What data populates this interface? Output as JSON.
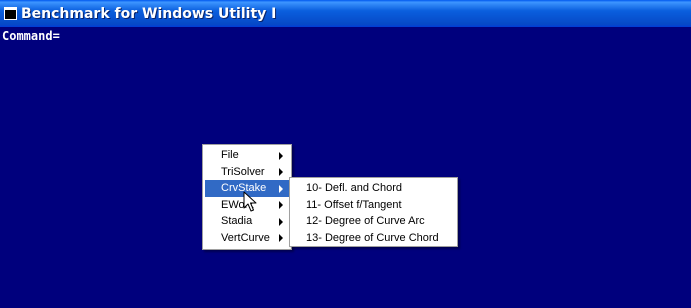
{
  "window": {
    "title": "Benchmark for Windows Utility I"
  },
  "console": {
    "prompt": "Command="
  },
  "main_menu": {
    "items": [
      {
        "label": "File",
        "has_submenu": true,
        "active": false
      },
      {
        "label": "TriSolver",
        "has_submenu": true,
        "active": false
      },
      {
        "label": "CrvStake",
        "has_submenu": true,
        "active": true
      },
      {
        "label": "EWork",
        "has_submenu": true,
        "active": false
      },
      {
        "label": "Stadia",
        "has_submenu": true,
        "active": false
      },
      {
        "label": "VertCurve",
        "has_submenu": true,
        "active": false
      }
    ]
  },
  "submenu": {
    "items": [
      {
        "label": "10- Defl. and Chord"
      },
      {
        "label": "11- Offset f/Tangent"
      },
      {
        "label": "12- Degree of Curve Arc"
      },
      {
        "label": "13- Degree of Curve Chord"
      }
    ]
  },
  "colors": {
    "console_bg": "#00007d",
    "titlebar": "#0a5fde",
    "menu_highlight": "#316ac5"
  }
}
